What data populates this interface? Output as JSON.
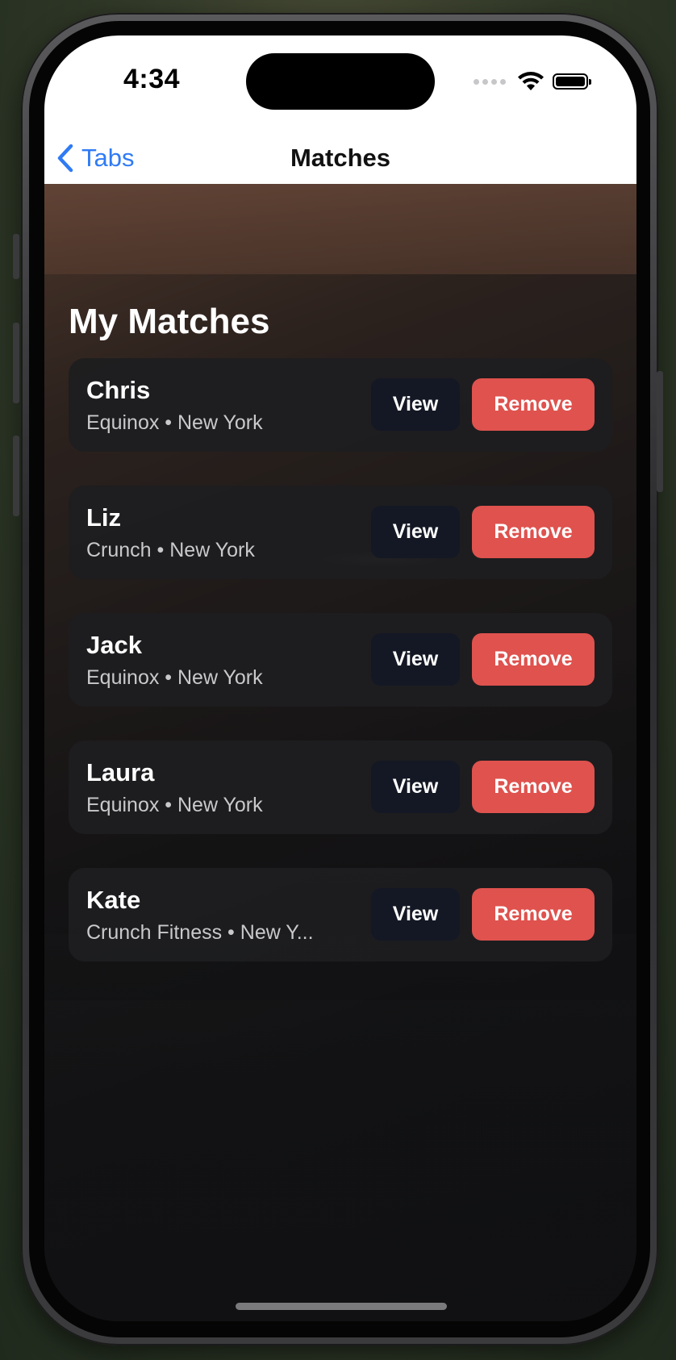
{
  "status_bar": {
    "time": "4:34"
  },
  "nav": {
    "back_label": "Tabs",
    "title": "Matches"
  },
  "page": {
    "section_title": "My Matches"
  },
  "matches": [
    {
      "name": "Chris",
      "subtitle": "Equinox • New York",
      "view_label": "View",
      "remove_label": "Remove"
    },
    {
      "name": "Liz",
      "subtitle": "Crunch • New York",
      "view_label": "View",
      "remove_label": "Remove"
    },
    {
      "name": "Jack",
      "subtitle": "Equinox • New York",
      "view_label": "View",
      "remove_label": "Remove"
    },
    {
      "name": "Laura",
      "subtitle": "Equinox • New York",
      "view_label": "View",
      "remove_label": "Remove"
    },
    {
      "name": "Kate",
      "subtitle": "Crunch Fitness • New Y...",
      "view_label": "View",
      "remove_label": "Remove"
    }
  ],
  "colors": {
    "accent_blue": "#2f7bf5",
    "remove_red": "#df524e",
    "view_button_bg": "#141824",
    "card_bg": "#1e1e20"
  },
  "icons": {
    "back": "chevron-left-icon",
    "wifi": "wifi-icon",
    "battery": "battery-icon",
    "signal": "cellular-signal-icon"
  }
}
